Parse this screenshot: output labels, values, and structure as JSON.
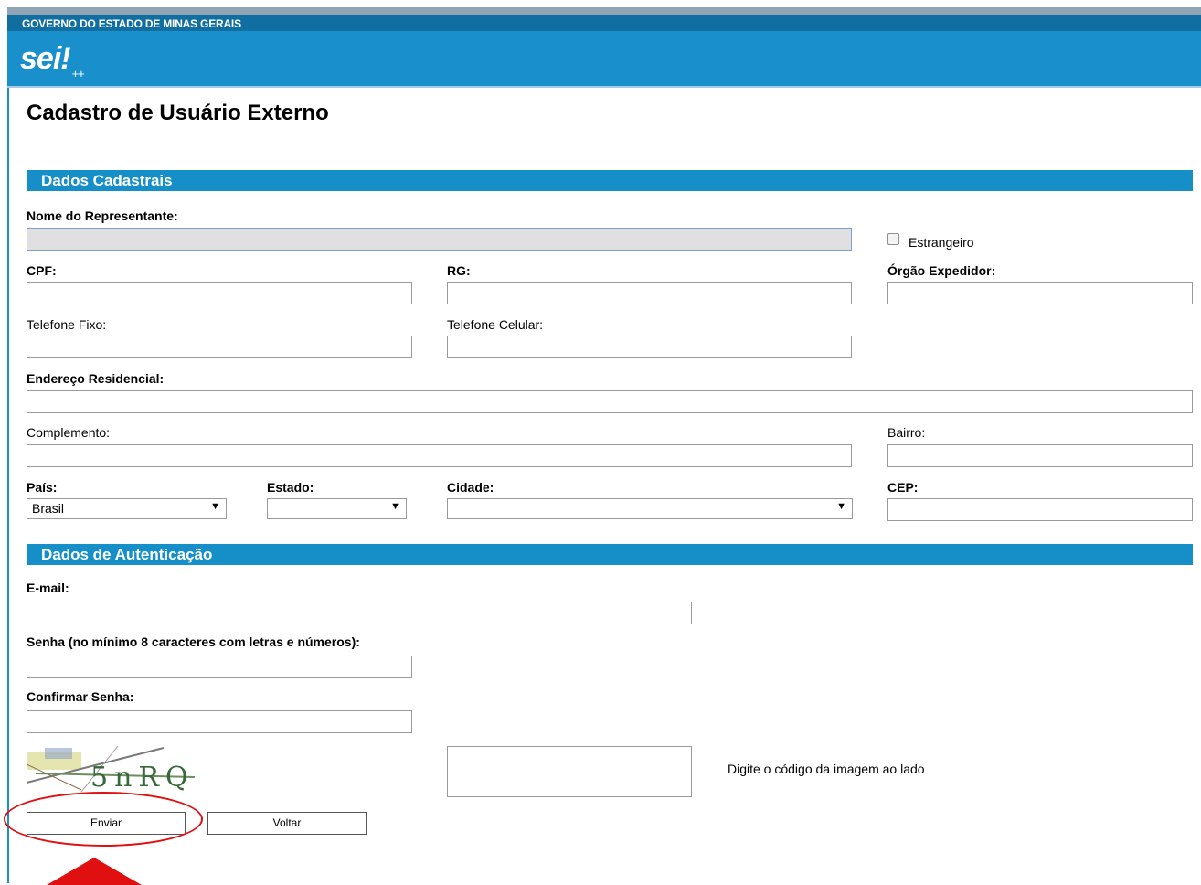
{
  "header": {
    "gov_title": "GOVERNO DO ESTADO DE MINAS GERAIS",
    "logo_text": "sei!",
    "logo_suffix": "++"
  },
  "page_title": "Cadastro de Usuário Externo",
  "dados_cadastrais": {
    "section_title": "Dados Cadastrais",
    "nome_label": "Nome do Representante:",
    "nome_value": "",
    "estrangeiro_label": "Estrangeiro",
    "cpf_label": "CPF:",
    "rg_label": "RG:",
    "orgao_label": "Órgão Expedidor:",
    "tel_fixo_label": "Telefone Fixo:",
    "tel_cel_label": "Telefone Celular:",
    "endereco_label": "Endereço Residencial:",
    "complemento_label": "Complemento:",
    "bairro_label": "Bairro:",
    "pais_label": "País:",
    "pais_value": "Brasil",
    "estado_label": "Estado:",
    "estado_value": "",
    "cidade_label": "Cidade:",
    "cidade_value": "",
    "cep_label": "CEP:"
  },
  "dados_autenticacao": {
    "section_title": "Dados de Autenticação",
    "email_label": "E-mail:",
    "senha_label": "Senha (no mínimo 8 caracteres com letras e números):",
    "confirmar_label": "Confirmar Senha:",
    "captcha_text": "5nRQ",
    "captcha_hint": "Digite o código da imagem ao lado"
  },
  "buttons": {
    "enviar": "Enviar",
    "voltar": "Voltar"
  },
  "annotation_color": "#e01010",
  "accent_color": "#168fc9"
}
